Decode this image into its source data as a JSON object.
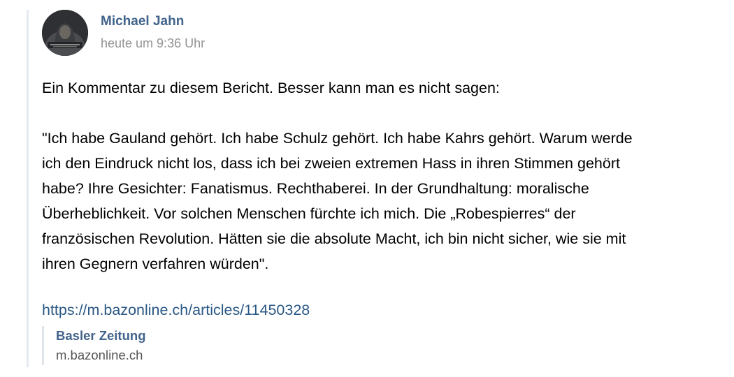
{
  "post": {
    "author": "Michael Jahn",
    "timestamp": "heute um 9:36 Uhr",
    "avatar_icon": "hooded-figure-avatar",
    "intro": "Ein Kommentar zu diesem Bericht. Besser kann man es nicht sagen:",
    "quote_lines": [
      "\"Ich habe Gauland gehört. Ich habe Schulz gehört. Ich habe Kahrs gehört. Warum werde",
      "ich den Eindruck nicht los, dass ich bei zweien extremen Hass in ihren Stimmen gehört",
      "habe? Ihre Gesichter: Fanatismus. Rechthaberei. In der Grundhaltung: moralische",
      "Überheblichkeit. Vor solchen Menschen fürchte ich mich. Die „Robespierres“ der",
      "französischen Revolution. Hätten sie die absolute Macht, ich bin nicht sicher, wie sie mit",
      "ihren Gegnern verfahren würden\"."
    ],
    "link": "https://m.bazonline.ch/articles/11450328",
    "snippet": {
      "title": "Basler Zeitung",
      "domain": "m.bazonline.ch"
    }
  },
  "colors": {
    "author": "#42648b",
    "link": "#2a5885",
    "timestamp": "#939393",
    "rule": "#e5e9ee"
  }
}
